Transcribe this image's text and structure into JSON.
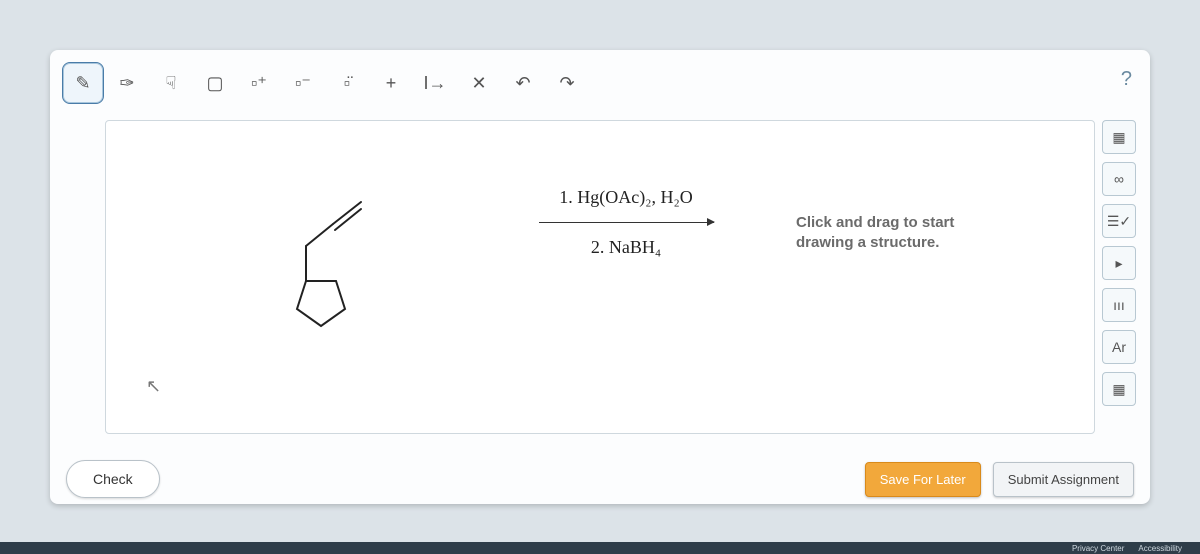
{
  "toolbar": {
    "tools": [
      {
        "id": "pencil",
        "name": "pencil-icon",
        "glyph": "✎",
        "selected": true
      },
      {
        "id": "lasso",
        "name": "lasso-icon",
        "glyph": "✑",
        "selected": false
      },
      {
        "id": "hand",
        "name": "hand-icon",
        "glyph": "☟",
        "selected": false
      },
      {
        "id": "box-dashed",
        "name": "marquee-icon",
        "glyph": "▢",
        "selected": false
      },
      {
        "id": "box-plus",
        "name": "charge-plus-icon",
        "glyph": "▫⁺",
        "selected": false
      },
      {
        "id": "box-minus",
        "name": "charge-minus-icon",
        "glyph": "▫⁻",
        "selected": false
      },
      {
        "id": "box-dots",
        "name": "lone-pair-icon",
        "glyph": "▫̈",
        "selected": false
      },
      {
        "id": "add",
        "name": "plus-icon",
        "glyph": "+",
        "selected": false
      },
      {
        "id": "text-arrow",
        "name": "text-arrow-icon",
        "glyph": "I→",
        "selected": false
      },
      {
        "id": "clear",
        "name": "clear-icon",
        "glyph": "✕",
        "selected": false
      },
      {
        "id": "undo",
        "name": "undo-icon",
        "glyph": "↶",
        "selected": false
      },
      {
        "id": "redo",
        "name": "redo-icon",
        "glyph": "↷",
        "selected": false
      }
    ],
    "help": "?"
  },
  "right_tools": [
    {
      "name": "grid-icon",
      "glyph": "▦"
    },
    {
      "name": "infinity-icon",
      "glyph": "∞"
    },
    {
      "name": "checklist-icon",
      "glyph": "☰✓"
    },
    {
      "name": "play-icon",
      "glyph": "▸"
    },
    {
      "name": "tally-icon",
      "glyph": "ııı"
    },
    {
      "name": "argon-icon",
      "glyph": "Ar"
    },
    {
      "name": "periodic-icon",
      "glyph": "▦"
    }
  ],
  "reaction": {
    "reagent1": "1. Hg(OAc)₂, H₂O",
    "reagent2": "2. NaBH₄"
  },
  "placeholder_hint": "Click and drag to start\ndrawing a structure.",
  "cursor_glyph": "↖",
  "buttons": {
    "check": "Check",
    "save_later": "Save For Later",
    "submit": "Submit Assignment"
  },
  "footer": {
    "privacy": "Privacy Center",
    "accessibility": "Accessibility"
  }
}
